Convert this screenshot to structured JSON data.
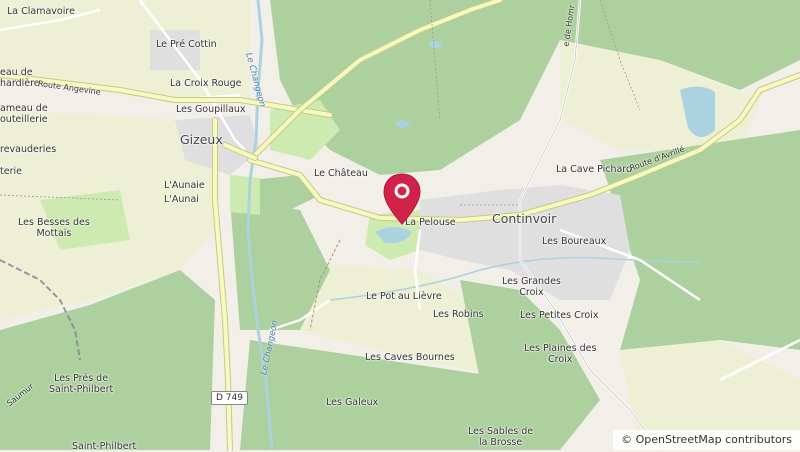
{
  "map": {
    "labels": {
      "la_clamavoire": "La Clamavoire",
      "le_pre_cottin": "Le Pré Cottin",
      "hameau_chardiere": "eau de\nhardière",
      "hameau_bouteillerie": "ameau de\nouteillerie",
      "la_croix_rouge": "La Croix Rouge",
      "les_goupillaux": "Les Goupillaux",
      "trevauderies": "revauderies",
      "terie": "terie",
      "gizeux": "Gizeux",
      "le_chateau": "Le Château",
      "launaie_1": "L'Aunaie",
      "launaie_2": "L'Aunai",
      "les_besses": "Les Besses des\nMottais",
      "la_pelouse": "La Pelouse",
      "continvoir": "Continvoir",
      "la_cave_pichard": "La Cave Pichard",
      "les_boureaux": "Les Boureaux",
      "les_grandes_croix": "Les Grandes\nCroix",
      "le_pot_au_lievre": "Le Pot au Lièvre",
      "les_robins": "Les Robins",
      "les_petites_croix": "Les Petites Croix",
      "les_caves_bournes": "Les Caves Bournes",
      "les_plaines": "Les Plaines des\nCroix",
      "les_pres_st_philbert": "Les Prés de\nSaint-Philbert",
      "les_galeux": "Les Galeux",
      "les_sables": "Les Sables de\nla Brosse",
      "saint_philbert": "Saint-Philbert"
    },
    "roads": {
      "route_angevine": "Route Angevine",
      "route_davrille": "Route d'Avrillé",
      "rue_de_hom": "e de Homr",
      "saumur": "Saumur",
      "d749": "D 749"
    },
    "rivers": {
      "changeon_1": "Le Changeon",
      "changeon_2": "Le Changeon"
    },
    "colors": {
      "background": "#f2efe9",
      "forest": "#add19e",
      "farmland": "#eef0d5",
      "meadow": "#cdebb0",
      "residential": "#e0dfdf",
      "water": "#aad3df",
      "road_yellow": "#f7fabf",
      "road_casing": "#c6c98a",
      "pin": "#d3224a"
    },
    "marker": {
      "name": "location-pin"
    }
  },
  "attribution": "© OpenStreetMap contributors"
}
